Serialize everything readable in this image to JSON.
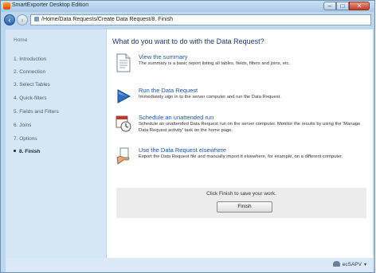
{
  "window": {
    "title": "SmartExporter Desktop Edition"
  },
  "controls": {
    "minimize": "–",
    "maximize": "□",
    "close": "✕"
  },
  "nav": {
    "back": "‹",
    "forward": "›",
    "breadcrumb": "/Home/Data Requests/Create Data Request/8. Finish"
  },
  "sidebar": {
    "home": "Home",
    "items": [
      {
        "label": "1. Introduction"
      },
      {
        "label": "2. Connection"
      },
      {
        "label": "3. Select Tables"
      },
      {
        "label": "4. Quick-filters"
      },
      {
        "label": "5. Fields and Filters"
      },
      {
        "label": "6. Joins"
      },
      {
        "label": "7. Options"
      },
      {
        "label": "8. Finish",
        "active": true
      }
    ]
  },
  "main": {
    "heading": "What do you want to do with the Data Request?",
    "options": [
      {
        "title": "View the summary",
        "description": "The summary is a basic report listing all tables, fields, filters and joins, etc.",
        "icon": "document-icon"
      },
      {
        "title": "Run the Data Request",
        "description": "Immediately sign in to the server computer and run the Data Request.",
        "icon": "play-icon"
      },
      {
        "title": "Schedule an unattended run",
        "description": "Schedule an unattended Data Request run on the server computer. Monitor the results by using the 'Manage Data Request activity' task on the home page.",
        "icon": "calendar-clock-icon"
      },
      {
        "title": "Use the Data Request elsewhere",
        "description": "Export the Data Request file and manually import it elsewhere, for example, on a different computer.",
        "icon": "hand-export-icon"
      }
    ],
    "finish_prompt": "Click Finish to save your work.",
    "finish_button": "Finish"
  },
  "status": {
    "user": "ecSAPV"
  },
  "colors": {
    "accent": "#1e58a8",
    "heading": "#1f3d78",
    "sidebar": "#d7e6f4",
    "frame": "#bcd7ee"
  }
}
